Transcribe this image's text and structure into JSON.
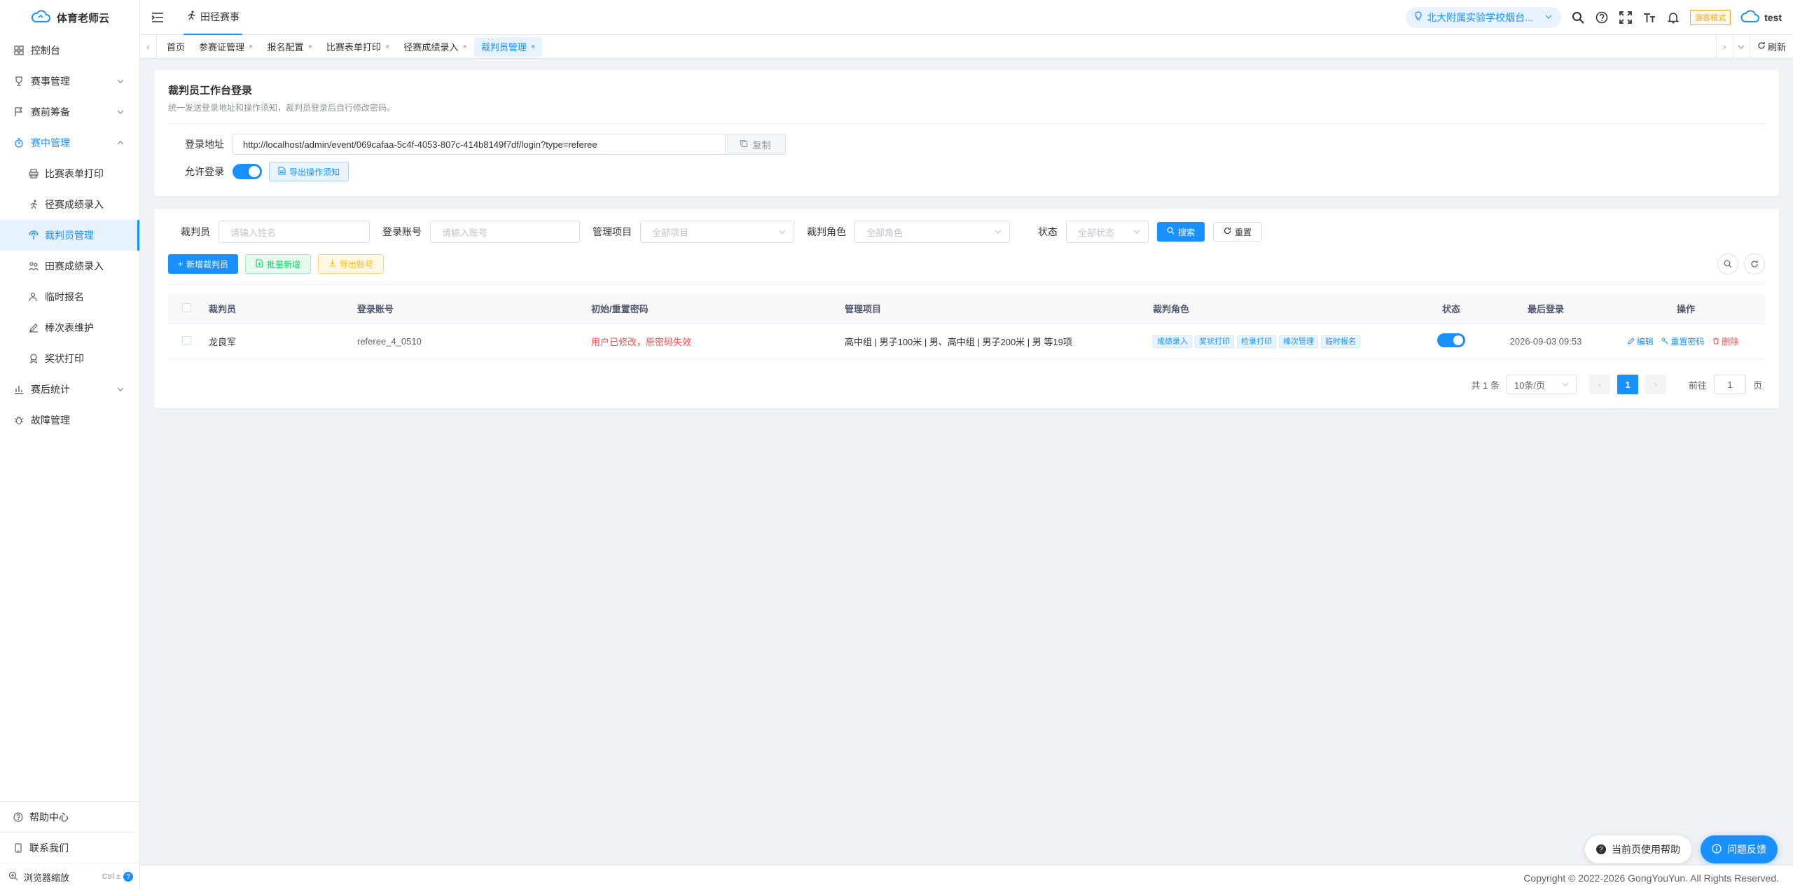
{
  "app": {
    "logo_text": "体育老师云"
  },
  "sidebar": {
    "items": [
      {
        "label": "控制台",
        "icon": "dashboard-icon"
      },
      {
        "label": "赛事管理",
        "icon": "trophy-icon"
      },
      {
        "label": "赛前筹备",
        "icon": "flag-icon"
      },
      {
        "label": "赛中管理",
        "icon": "timer-icon"
      }
    ],
    "submenu": [
      {
        "label": "比赛表单打印",
        "icon": "print-icon"
      },
      {
        "label": "径赛成绩录入",
        "icon": "run-icon"
      },
      {
        "label": "裁判员管理",
        "icon": "referee-icon"
      },
      {
        "label": "田赛成绩录入",
        "icon": "field-icon"
      },
      {
        "label": "临时报名",
        "icon": "user-plus-icon"
      },
      {
        "label": "棒次表维护",
        "icon": "edit-icon"
      },
      {
        "label": "奖状打印",
        "icon": "award-icon"
      }
    ],
    "after_items": [
      {
        "label": "赛后统计",
        "icon": "chart-icon"
      },
      {
        "label": "故障管理",
        "icon": "bug-icon"
      }
    ],
    "bottom": {
      "help": "帮助中心",
      "contact": "联系我们",
      "zoom": "浏览器缩放",
      "zoom_hint": "Ctrl ±",
      "zoom_q": "?"
    }
  },
  "header": {
    "title": "田径赛事",
    "school": "北大附属实验学校烟台...",
    "visitor_badge": "游客模式",
    "user": "test"
  },
  "tabs": [
    {
      "label": "首页",
      "closable": false,
      "active": false
    },
    {
      "label": "参赛证管理",
      "closable": true,
      "active": false
    },
    {
      "label": "报名配置",
      "closable": true,
      "active": false
    },
    {
      "label": "比赛表单打印",
      "closable": true,
      "active": false
    },
    {
      "label": "径赛成绩录入",
      "closable": true,
      "active": false
    },
    {
      "label": "裁判员管理",
      "closable": true,
      "active": true
    }
  ],
  "tabs_refresh": "刷新",
  "login_card": {
    "title": "裁判员工作台登录",
    "desc": "统一发送登录地址和操作须知，裁判员登录后自行修改密码。",
    "url_label": "登录地址",
    "url": "http://localhost/admin/event/069cafaa-5c4f-4053-807c-414b8149f7df/login?type=referee",
    "copy": "复制",
    "allow_label": "允许登录",
    "allow_on": true,
    "export_notice": "导出操作须知"
  },
  "filters": {
    "referee_label": "裁判员",
    "referee_placeholder": "请输入姓名",
    "account_label": "登录账号",
    "account_placeholder": "请输入账号",
    "project_label": "管理项目",
    "project_placeholder": "全部项目",
    "role_label": "裁判角色",
    "role_placeholder": "全部角色",
    "status_label": "状态",
    "status_placeholder": "全部状态",
    "search": "搜索",
    "reset": "重置"
  },
  "actions": {
    "add": "新增裁判员",
    "batch_add": "批量新增",
    "export_accounts": "导出账号"
  },
  "table": {
    "headers": {
      "referee": "裁判员",
      "account": "登录账号",
      "password": "初始/重置密码",
      "projects": "管理项目",
      "roles": "裁判角色",
      "status": "状态",
      "last_login": "最后登录",
      "ops": "操作"
    },
    "rows": [
      {
        "referee": "龙良军",
        "account": "referee_4_0510",
        "password": "用户已修改，原密码失效",
        "projects": "高中组 | 男子100米 | 男、高中组 | 男子200米 | 男 等19项",
        "roles": [
          "成绩录入",
          "奖状打印",
          "检录打印",
          "棒次管理",
          "临时报名"
        ],
        "status_on": true,
        "last_login": "2026-09-03 09:53",
        "edit": "编辑",
        "reset_pwd": "重置密码",
        "delete": "删除"
      }
    ]
  },
  "pager": {
    "total": "共 1 条",
    "page_size": "10条/页",
    "current": "1",
    "goto": "前往",
    "goto_value": "1",
    "page_unit": "页"
  },
  "footer": {
    "copyright": "Copyright © 2022-2026 GongYouYun. All Rights Reserved."
  },
  "floating": {
    "help": "当前页使用帮助",
    "feedback": "问题反馈"
  },
  "colors": {
    "primary": "#1890ff",
    "danger": "#ff4949",
    "success": "#13ce66",
    "warning": "#ffba00"
  }
}
